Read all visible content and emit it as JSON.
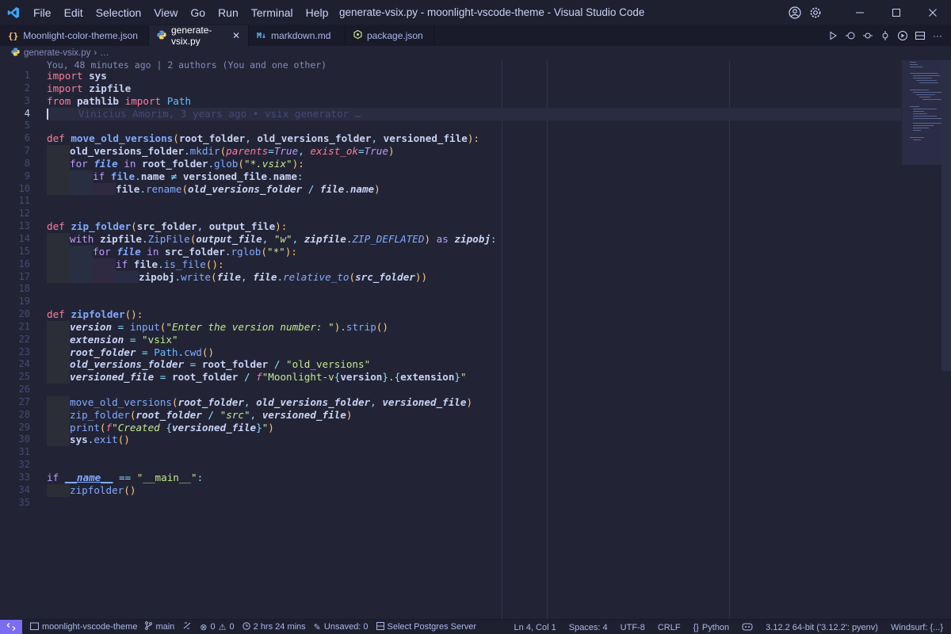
{
  "titlebar": {
    "menu": [
      "File",
      "Edit",
      "Selection",
      "View",
      "Go",
      "Run",
      "Terminal",
      "Help"
    ],
    "window_title": "generate-vsix.py - moonlight-vscode-theme - Visual Studio Code"
  },
  "tabs": [
    {
      "icon": "{}",
      "label": "Moonlight-color-theme.json",
      "active": false
    },
    {
      "icon": "py",
      "label": "generate-vsix.py",
      "active": true
    },
    {
      "icon": "md",
      "label": "markdown.md",
      "active": false
    },
    {
      "icon": "npm",
      "label": "package.json",
      "active": false
    }
  ],
  "breadcrumb": {
    "file": "generate-vsix.py",
    "sep": "›",
    "rest": "…"
  },
  "editor": {
    "blame_header": "You, 48 minutes ago | 2 authors (You and one other)",
    "inline_blame": "Vinicius Amorim, 3 years ago • vsix generator …",
    "active_line": 4,
    "line_numbers": [
      "1",
      "2",
      "3",
      "4",
      "5",
      "6",
      "7",
      "8",
      "9",
      "10",
      "11",
      "12",
      "13",
      "14",
      "15",
      "16",
      "17",
      "18",
      "19",
      "20",
      "21",
      "22",
      "23",
      "24",
      "25",
      "26",
      "27",
      "28",
      "29",
      "30",
      "31",
      "32",
      "33",
      "34",
      "35"
    ],
    "t": {
      "import": "import",
      "from": "from",
      "def": "def",
      "for": "for",
      "in": "in",
      "if": "if",
      "with": "with",
      "as": "as",
      "true": "True",
      "sys": "sys",
      "zipfile": "zipfile",
      "pathlib": "pathlib",
      "Path": "Path",
      "move_old_versions": "move_old_versions",
      "root_folder": "root_folder",
      "old_versions_folder": "old_versions_folder",
      "versioned_file": "versioned_file",
      "mkdir": "mkdir",
      "parents": "parents",
      "exist_ok": "exist_ok",
      "file": "file",
      "glob": "glob",
      "vsix_glob": "\"*.vsix\"",
      "name": "name",
      "ne": "≠",
      "rename": "rename",
      "slash": "/",
      "zip_folder": "zip_folder",
      "src_folder": "src_folder",
      "output_file": "output_file",
      "ZipFile": "ZipFile",
      "w": "\"w\"",
      "ZIP_DEFLATED": "ZIP_DEFLATED",
      "zipobj": "zipobj",
      "rglob": "rglob",
      "star": "\"*\"",
      "is_file": "is_file",
      "write": "write",
      "relative_to": "relative_to",
      "zipfolder": "zipfolder",
      "version": "version",
      "input": "input",
      "prompt": "\"Enter the version number: \"",
      "strip": "strip",
      "extension": "extension",
      "vsix": "\"vsix\"",
      "cwd": "cwd",
      "old_versions_str": "\"old_versions\"",
      "f": "f",
      "moonlight_str": "\"Moonlight-v",
      "dot": ".",
      "quote": "\"",
      "src": "\"src\"",
      "print": "print",
      "created": "\"Created ",
      "exit": "exit",
      "dunder_name": "__name__",
      "eqeq": "==",
      "main_str": "\"__main__\""
    }
  },
  "statusbar": {
    "repo": "moonlight-vscode-theme",
    "branch": "main",
    "problems": "0",
    "warnings": "0",
    "time": "2 hrs 24 mins",
    "unsaved": "Unsaved: 0",
    "postgres": "Select Postgres Server",
    "cursor": "Ln 4, Col 1",
    "spaces": "Spaces: 4",
    "encoding": "UTF-8",
    "eol": "CRLF",
    "language": "Python",
    "interpreter": "3.12.2 64-bit ('3.12.2': pyenv)",
    "windsurf": "Windsurf: {...}"
  },
  "colors": {
    "accent": "#7b6cf0",
    "keyword": "#fc7b9b",
    "function": "#82aaff",
    "string": "#c3e88d",
    "param": "#ffc777",
    "background": "#222436"
  }
}
